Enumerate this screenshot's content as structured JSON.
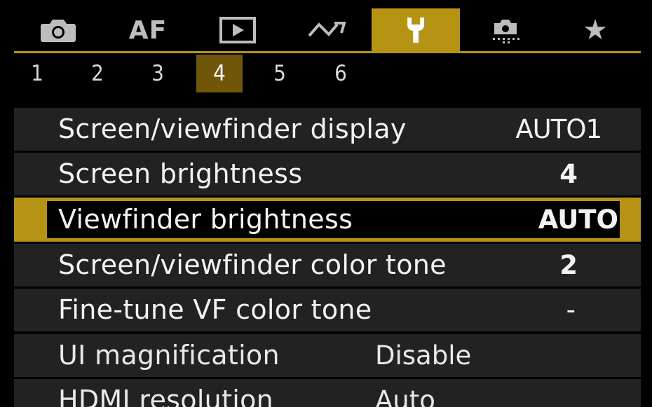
{
  "tabs": [
    {
      "icon": "camera-icon",
      "label": ""
    },
    {
      "icon": "af-icon",
      "label": "AF"
    },
    {
      "icon": "playback-icon",
      "label": ""
    },
    {
      "icon": "wireless-icon",
      "label": ""
    },
    {
      "icon": "wrench-icon",
      "label": "",
      "active": true
    },
    {
      "icon": "custom-shooting-icon",
      "label": ""
    },
    {
      "icon": "star-icon",
      "label": "★"
    }
  ],
  "pages": [
    "1",
    "2",
    "3",
    "4",
    "5",
    "6"
  ],
  "active_page": "4",
  "menu": [
    {
      "label": "Screen/viewfinder display",
      "value": "AUTO1"
    },
    {
      "label": "Screen brightness",
      "value": "4"
    },
    {
      "label": "Viewfinder brightness",
      "value": "AUTO",
      "selected": true
    },
    {
      "label": "Screen/viewfinder color tone",
      "value": "2"
    },
    {
      "label": "Fine-tune VF color tone",
      "value": "-"
    },
    {
      "label": "UI magnification",
      "value": "Disable"
    },
    {
      "label": "HDMI resolution",
      "value": "Auto"
    }
  ],
  "colors": {
    "accent": "#b69313",
    "page_highlight": "#6f5608",
    "row_bg": "#222222",
    "background": "#000000"
  }
}
